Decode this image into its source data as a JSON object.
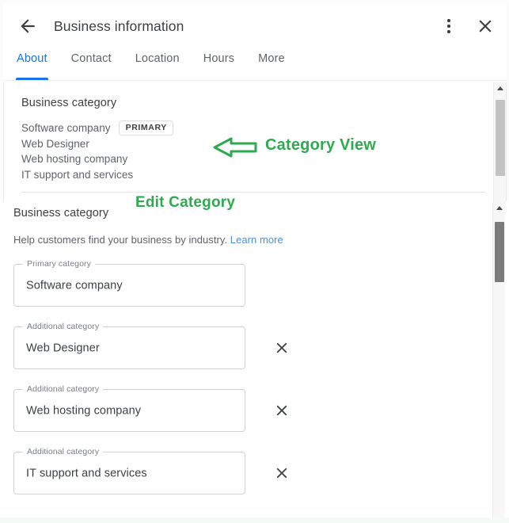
{
  "window": {
    "title": "Business information",
    "back_icon": "arrow-back-icon",
    "menu_icon": "more-vert-icon",
    "close_icon": "close-icon"
  },
  "tabs": [
    {
      "label": "About",
      "active": true
    },
    {
      "label": "Contact",
      "active": false
    },
    {
      "label": "Location",
      "active": false
    },
    {
      "label": "Hours",
      "active": false
    },
    {
      "label": "More",
      "active": false
    }
  ],
  "category_view": {
    "title": "Business category",
    "primary_badge": "PRIMARY",
    "categories": [
      "Software company",
      "Web Designer",
      "Web hosting company",
      "IT support and services"
    ]
  },
  "annotations": {
    "category_view": "Category View",
    "edit_category": "Edit Category",
    "color": "#2eaa50",
    "arrow_icon": "left-arrow-outline-icon"
  },
  "edit_panel": {
    "heading": "Business category",
    "help_text": "Help customers find your business by industry.",
    "learn_more": "Learn more",
    "fields": [
      {
        "label": "Primary category",
        "value": "Software company",
        "removable": false
      },
      {
        "label": "Additional category",
        "value": "Web Designer",
        "removable": true
      },
      {
        "label": "Additional category",
        "value": "Web hosting company",
        "removable": true
      },
      {
        "label": "Additional category",
        "value": "IT support and services",
        "removable": true
      }
    ],
    "remove_icon": "close-icon"
  },
  "scrollbars": {
    "outer": "outer-scrollbar",
    "inner": "inner-scrollbar"
  }
}
